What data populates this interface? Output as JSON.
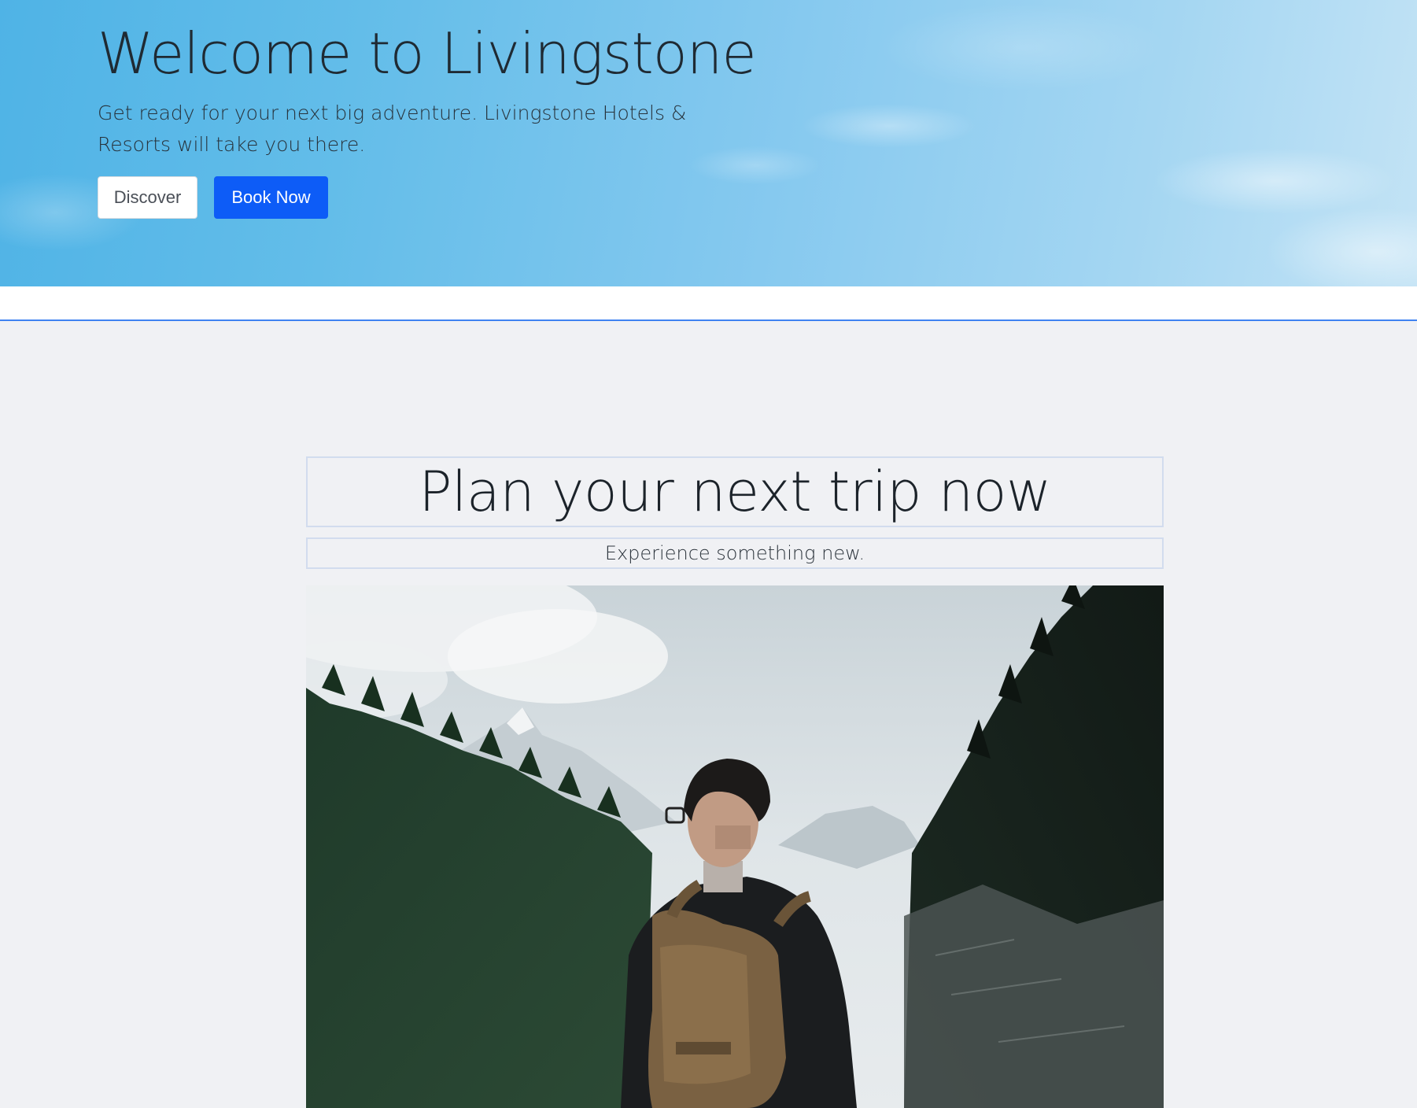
{
  "hero": {
    "title": "Welcome to Livingstone",
    "subtitle": "Get ready for your next big adventure. Livingstone Hotels & Resorts will take you there.",
    "discover_label": "Discover",
    "book_label": "Book Now"
  },
  "intro": {
    "title": "Plan your next trip now",
    "subtitle": "Experience something new."
  },
  "colors": {
    "primary_button": "#0d5cf7",
    "divider": "#3f82f1",
    "section_background": "#f0f1f4"
  }
}
